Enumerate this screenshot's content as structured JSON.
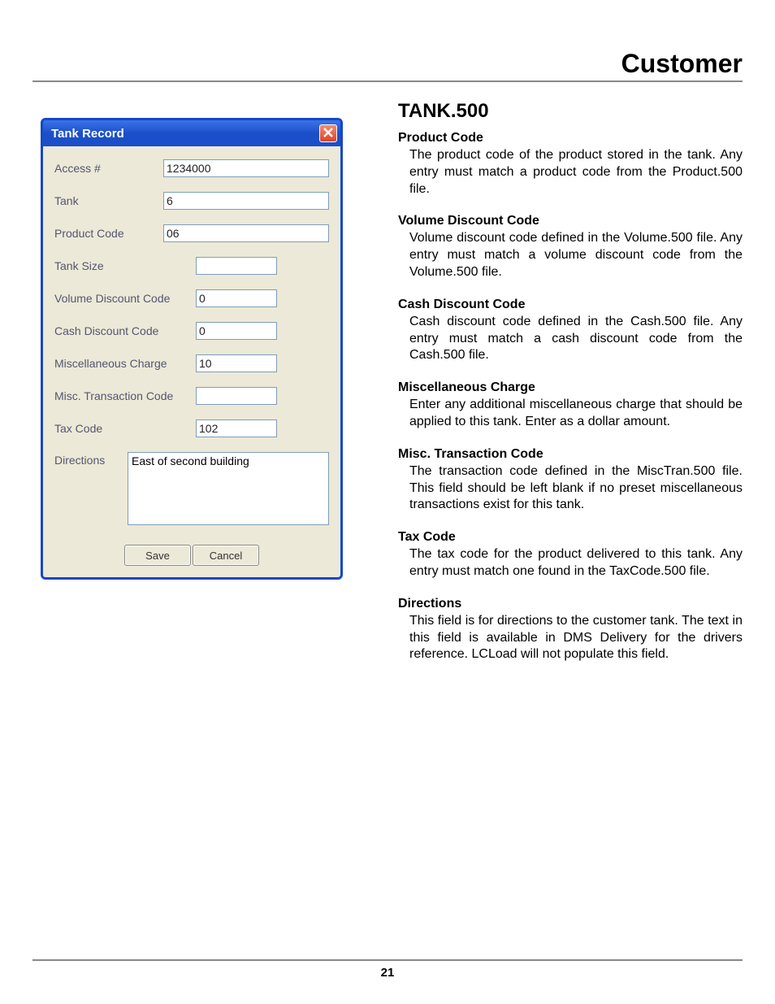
{
  "header": {
    "title": "Customer"
  },
  "footer": {
    "page_number": "21"
  },
  "dialog": {
    "title": "Tank Record",
    "fields": {
      "access_label": "Access #",
      "access_value": "1234000",
      "tank_label": "Tank",
      "tank_value": "6",
      "product_code_label": "Product Code",
      "product_code_value": "06",
      "tank_size_label": "Tank Size",
      "tank_size_value": "",
      "vol_disc_label": "Volume Discount Code",
      "vol_disc_value": "0",
      "cash_disc_label": "Cash Discount Code",
      "cash_disc_value": "0",
      "misc_charge_label": "Miscellaneous Charge",
      "misc_charge_value": "10",
      "misc_txn_label": "Misc. Transaction Code",
      "misc_txn_value": "",
      "tax_code_label": "Tax Code",
      "tax_code_value": "102",
      "directions_label": "Directions",
      "directions_value": "East of second building"
    },
    "buttons": {
      "save": "Save",
      "cancel": "Cancel"
    }
  },
  "doc": {
    "section_title": "TANK.500",
    "items": [
      {
        "heading": "Product Code",
        "body": "The product code of the product stored in the tank. Any entry must match a product code from the Product.500 file."
      },
      {
        "heading": "Volume Discount Code",
        "body": "Volume discount code defined in the Volume.500 file. Any entry must match a volume discount code from the Volume.500 file."
      },
      {
        "heading": "Cash Discount Code",
        "body": "Cash discount code defined in the Cash.500 file. Any entry must match a cash discount code from the Cash.500 file."
      },
      {
        "heading": "Miscellaneous Charge",
        "body": "Enter any additional miscellaneous charge that should be applied to this tank. Enter as a dollar amount."
      },
      {
        "heading": "Misc. Transaction Code",
        "body": "The transaction code defined in the MiscTran.500 file. This field should be left blank if no preset miscellaneous transactions exist for this tank."
      },
      {
        "heading": "Tax Code",
        "body": "The tax code for the product delivered to this tank. Any entry must match one found in the TaxCode.500 file."
      },
      {
        "heading": "Directions",
        "body": "This field is for directions to the customer tank. The text in this field is available in DMS Delivery for the drivers reference. LCLoad will not populate this field."
      }
    ]
  }
}
